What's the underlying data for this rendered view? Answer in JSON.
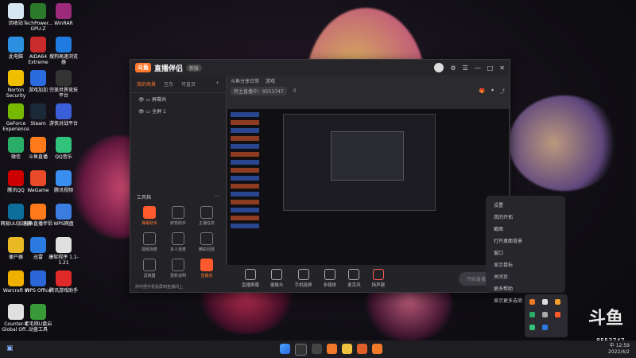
{
  "desktop": {
    "icons": [
      {
        "label": "回收站",
        "color": "#d8e6f2"
      },
      {
        "label": "TechPower... GPU-Z",
        "color": "#2b7a2b"
      },
      {
        "label": "WinRAR",
        "color": "#9b2a7a"
      },
      {
        "label": "此电脑",
        "color": "#2d8fe0"
      },
      {
        "label": "AIDA64 Extreme",
        "color": "#c92a2a"
      },
      {
        "label": "搜狗高速浏览器",
        "color": "#1f7be0"
      },
      {
        "label": "Norton Security",
        "color": "#f0c000"
      },
      {
        "label": "游戏加加",
        "color": "#2a6be0"
      },
      {
        "label": "完美世界竞技平台",
        "color": "#333"
      },
      {
        "label": "GeForce Experience",
        "color": "#76b900"
      },
      {
        "label": "Steam",
        "color": "#1b2838"
      },
      {
        "label": "游侠对战平台",
        "color": "#3a5fd8"
      },
      {
        "label": "微信",
        "color": "#2aae67"
      },
      {
        "label": "斗鱼直播",
        "color": "#ff7a1a"
      },
      {
        "label": "QQ音乐",
        "color": "#31c27c"
      },
      {
        "label": "腾讯QQ",
        "color": "#c00"
      },
      {
        "label": "WeGame",
        "color": "#e84a2a"
      },
      {
        "label": "腾讯视频",
        "color": "#3a8ef0"
      },
      {
        "label": "网易UU加速器",
        "color": "#0b6e9b"
      },
      {
        "label": "斗鱼直播伴侣",
        "color": "#ff7a1a"
      },
      {
        "label": "WPS网盘",
        "color": "#3b7ce0"
      },
      {
        "label": "便户器",
        "color": "#e8b923"
      },
      {
        "label": "迅雷",
        "color": "#2a7ae0"
      },
      {
        "label": "康软程序 1.1-1.21",
        "color": "#e0e0e0"
      },
      {
        "label": "Warcraft III",
        "color": "#f0b000"
      },
      {
        "label": "WPS Office",
        "color": "#2a66d6"
      },
      {
        "label": "腾讯游戏助手",
        "color": "#e02a2a"
      },
      {
        "label": "Counter-S Global Off...",
        "color": "#e0e0e0"
      },
      {
        "label": "老毛桃U盘启动盘工具",
        "color": "#3a9a3a"
      }
    ]
  },
  "window": {
    "app_title": "直播伴侣",
    "logo": "斗鱼",
    "version_badge": "新版",
    "sidebar_tabs": [
      "我的场景",
      "互东",
      "可直页"
    ],
    "scene_items": [
      "屏幕共",
      "全屏 1"
    ],
    "tools_title": "工具箱",
    "tools": [
      {
        "label": "弹幕助手",
        "hot": true
      },
      {
        "label": "房管助手",
        "hot": false
      },
      {
        "label": "主播任务",
        "hot": false
      },
      {
        "label": "视频连麦",
        "hot": false
      },
      {
        "label": "多人连麦",
        "hot": false
      },
      {
        "label": "精彩回放",
        "hot": false
      },
      {
        "label": "滤镜器",
        "hot": false
      },
      {
        "label": "更新说明",
        "hot": false
      },
      {
        "label": "直播间",
        "hot": true
      }
    ],
    "sidebar_note": "你可把手机投屏到直播间上",
    "top_tabs": [
      "斗鱼分享日常",
      "游戏"
    ],
    "room_id_label": "房主直播中：8553747",
    "likes": "0",
    "bottom_buttons": [
      "直播屏幕",
      "摄像头",
      "手机投屏",
      "多媒体",
      "麦克风",
      "扬声器"
    ],
    "go_live": "开始直播"
  },
  "context_menu": [
    "设置",
    "我的开拓",
    "截图",
    "打开桌面背景",
    "窗口",
    "显示鼠标",
    "关闭页",
    "更多帮助",
    "显示更多选项"
  ],
  "watermark": {
    "logo": "斗鱼",
    "room": "8553747"
  },
  "taskbar": {
    "time": "12:59",
    "date": "2022/4/2",
    "ime": "中"
  }
}
